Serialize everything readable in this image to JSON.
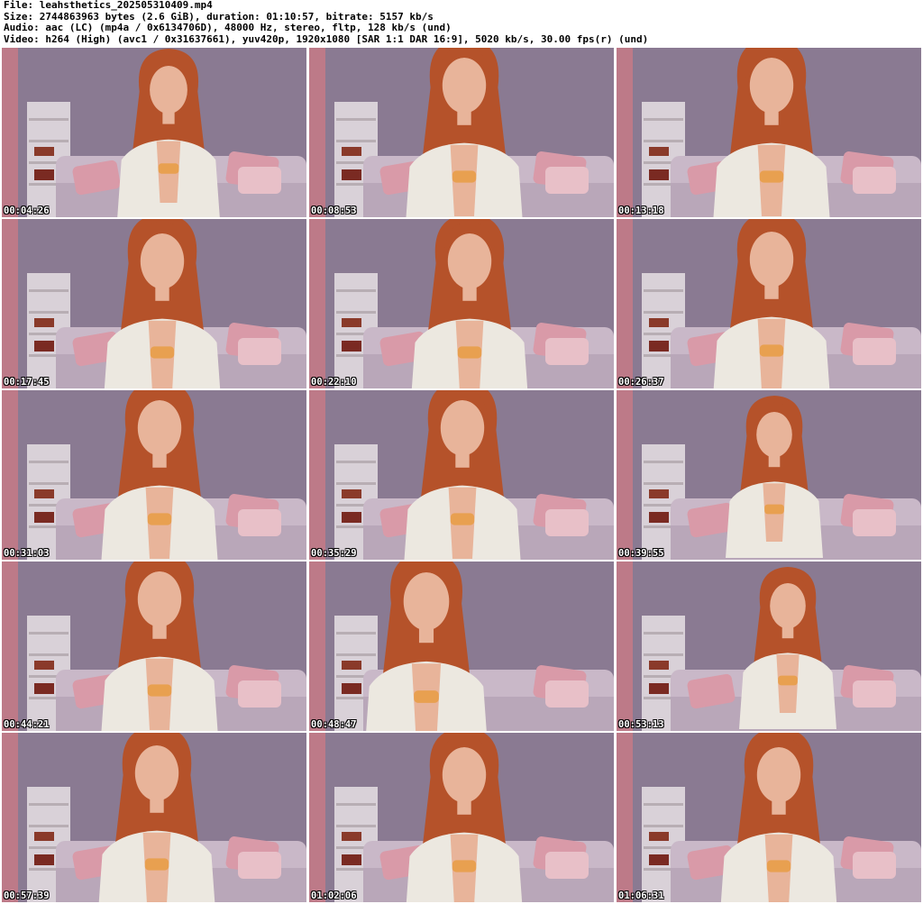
{
  "header": {
    "line1": "File: leahsthetics_202505310409.mp4",
    "line2": "Size: 2744863963 bytes (2.6 GiB), duration: 01:10:57, bitrate: 5157 kb/s",
    "line3": "Audio: aac (LC) (mp4a / 0x6134706D), 48000 Hz, stereo, fltp, 128 kb/s (und)",
    "line4": "Video: h264 (High) (avc1 / 0x31637661), yuv420p, 1920x1080 [SAR 1:1 DAR 16:9], 5020 kb/s, 30.00 fps(r) (und)"
  },
  "thumbnails": [
    {
      "time": "00:04:26"
    },
    {
      "time": "00:08:53"
    },
    {
      "time": "00:13:18"
    },
    {
      "time": "00:17:45"
    },
    {
      "time": "00:22:10"
    },
    {
      "time": "00:26:37"
    },
    {
      "time": "00:31:03"
    },
    {
      "time": "00:35:29"
    },
    {
      "time": "00:39:55"
    },
    {
      "time": "00:44:21"
    },
    {
      "time": "00:48:47"
    },
    {
      "time": "00:53:13"
    },
    {
      "time": "00:57:39"
    },
    {
      "time": "01:02:06"
    },
    {
      "time": "01:06:31"
    }
  ],
  "colors": {
    "wall": "#8a7a92",
    "sofa": "#c9b8c8",
    "pillow": "#d99aa8",
    "hair": "#b5522a",
    "shirt": "#ece8e0",
    "skin": "#e8b49a",
    "shelf": "#e6e1e4",
    "curtain": "#c97a86"
  }
}
